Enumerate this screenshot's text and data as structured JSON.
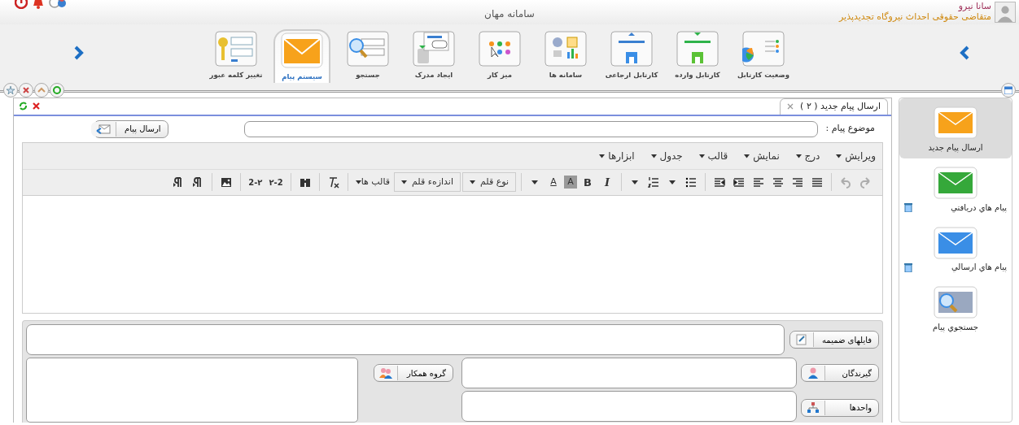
{
  "header": {
    "title": "سامانه مهان",
    "user_name": "سانا نیرو",
    "user_role": "متقاضی حقوقی احداث نیروگاه تجدیدپذیر"
  },
  "toolbar": {
    "tiles": [
      {
        "label": "وضعیت کارتابل",
        "selected": false
      },
      {
        "label": "کارتابل وارده",
        "selected": false
      },
      {
        "label": "کارتابل ارجاعی",
        "selected": false
      },
      {
        "label": "سامانه ها",
        "selected": false
      },
      {
        "label": "میز کار",
        "selected": false
      },
      {
        "label": "ایجاد مدرک",
        "selected": false
      },
      {
        "label": "جستجو",
        "selected": false
      },
      {
        "label": "سیستم پیام",
        "selected": true
      },
      {
        "label": "تغییر کلمه عبور",
        "selected": false
      }
    ]
  },
  "sidebar": {
    "items": [
      {
        "label": "ارسال پیام جدید",
        "selected": true,
        "deletable": false
      },
      {
        "label": "پیام هاي دريافتي",
        "selected": false,
        "deletable": true
      },
      {
        "label": "پیام هاي ارسالي",
        "selected": false,
        "deletable": true
      },
      {
        "label": "جستجوي پیام",
        "selected": false,
        "deletable": false
      }
    ]
  },
  "tab": {
    "title": "ارسال پیام جدید ( ۲ )"
  },
  "compose": {
    "subject_label": "موضوع پیام :",
    "send_button": "ارسال پیام",
    "menus": [
      "ویرایش",
      "درج",
      "نمایش",
      "قالب",
      "جدول",
      "ابزارها"
    ],
    "tools": [
      {
        "kind": "redo",
        "disabled": true
      },
      {
        "kind": "undo",
        "disabled": true
      },
      {
        "kind": "sep"
      },
      {
        "kind": "justify"
      },
      {
        "kind": "align-right"
      },
      {
        "kind": "align-center"
      },
      {
        "kind": "align-left"
      },
      {
        "kind": "indent"
      },
      {
        "kind": "outdent"
      },
      {
        "kind": "sep"
      },
      {
        "kind": "bullets"
      },
      {
        "kind": "caret"
      },
      {
        "kind": "numbers"
      },
      {
        "kind": "caret"
      },
      {
        "kind": "sep"
      },
      {
        "kind": "text",
        "label": "I"
      },
      {
        "kind": "text",
        "label": "B"
      },
      {
        "kind": "text",
        "label": "A"
      },
      {
        "kind": "text",
        "label": "A"
      },
      {
        "kind": "caret"
      },
      {
        "kind": "sep"
      },
      {
        "kind": "dropdown",
        "label": "نوع قلم"
      },
      {
        "kind": "dropdown",
        "label": "اندازهء قلم"
      },
      {
        "kind": "menu",
        "label": "قالب ها"
      },
      {
        "kind": "sep"
      },
      {
        "kind": "clear"
      },
      {
        "kind": "sep"
      },
      {
        "kind": "find"
      },
      {
        "kind": "sep"
      },
      {
        "kind": "text",
        "label": "۲-2"
      },
      {
        "kind": "text",
        "label": "2-۲"
      },
      {
        "kind": "sep"
      },
      {
        "kind": "image"
      },
      {
        "kind": "sep"
      },
      {
        "kind": "pilcrow"
      },
      {
        "kind": "pilcrow"
      }
    ],
    "attachments_button": "فایلهای ضمیمه",
    "recipients_button": "گیرندگان",
    "units_button": "واحدها",
    "group_button": "گروه همکار"
  }
}
